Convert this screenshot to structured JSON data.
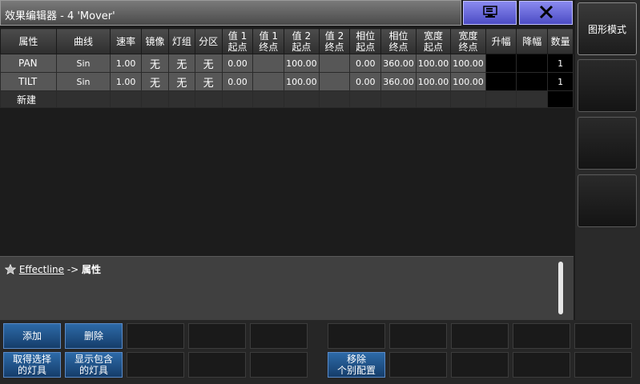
{
  "window": {
    "title": "效果编辑器 - 4 'Mover'",
    "pin_icon": "pin-icon",
    "close_icon": "close-icon"
  },
  "sidebar": {
    "buttons": [
      "图形模式",
      "",
      "",
      ""
    ]
  },
  "table": {
    "headers": [
      "属性",
      "曲线",
      "速率",
      "镜像",
      "灯组",
      "分区",
      "值 1\n起点",
      "值 1\n终点",
      "值 2\n起点",
      "值 2\n终点",
      "相位\n起点",
      "相位\n终点",
      "宽度\n起点",
      "宽度\n终点",
      "升幅",
      "降幅",
      "数量"
    ],
    "rows": [
      [
        "PAN",
        "Sin",
        "1.00",
        "无",
        "无",
        "无",
        "0.00",
        "",
        "100.00",
        "",
        "0.00",
        "360.00",
        "100.00",
        "100.00",
        "",
        "",
        "1"
      ],
      [
        "TILT",
        "Sin",
        "1.00",
        "无",
        "无",
        "无",
        "0.00",
        "",
        "100.00",
        "",
        "0.00",
        "360.00",
        "100.00",
        "100.00",
        "",
        "",
        "1"
      ]
    ],
    "new_row_label": "新建"
  },
  "command": {
    "link": "Effectline",
    "arrow": " -> ",
    "target": "属性",
    "icon": "star-icon"
  },
  "bottom": {
    "add": "添加",
    "delete": "删除",
    "get_selected": "取得选择\n的灯具",
    "show_contained": "显示包含\n的灯具",
    "remove_individual": "移除\n个别配置"
  },
  "colors": {
    "accent_blue": "#2d6aa8",
    "title_button": "#6464dc"
  }
}
